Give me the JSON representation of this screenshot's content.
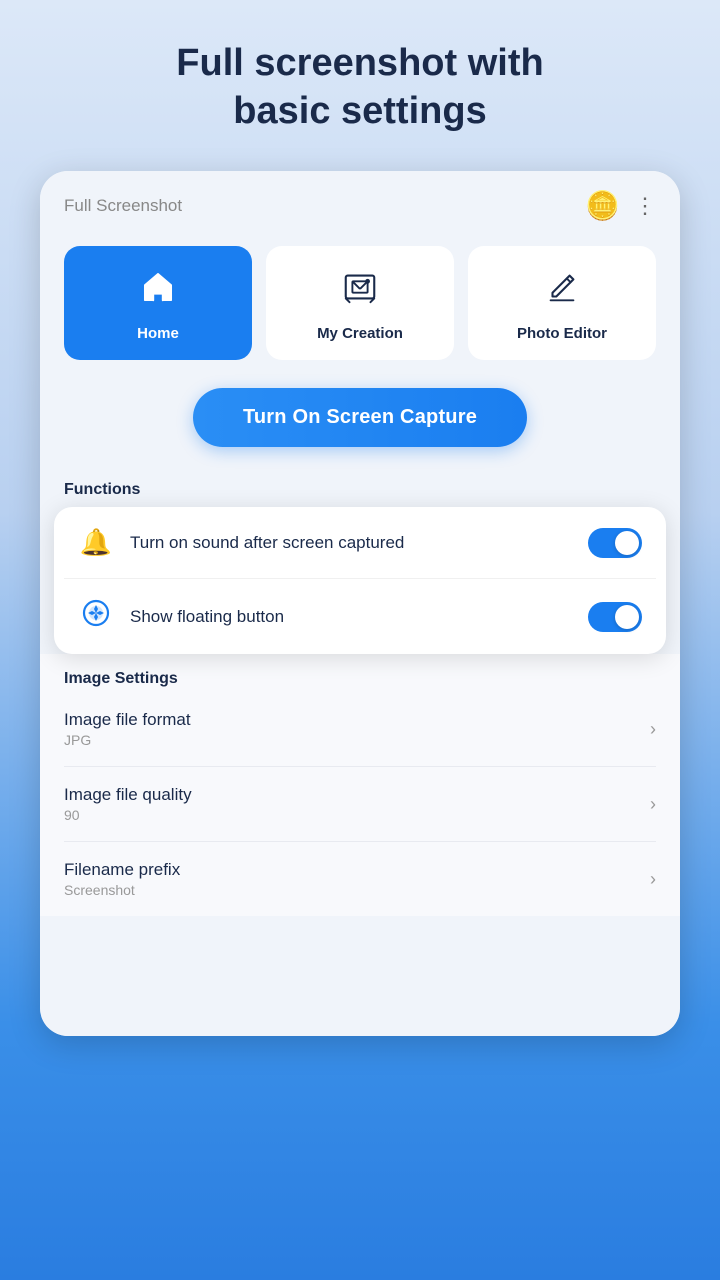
{
  "page": {
    "title_line1": "Full screenshot with",
    "title_line2": "basic settings"
  },
  "app_bar": {
    "title": "Full Screenshot",
    "avatar_emoji": "🪙"
  },
  "nav_tiles": [
    {
      "id": "home",
      "label": "Home",
      "active": true
    },
    {
      "id": "my-creation",
      "label": "My Creation",
      "active": false
    },
    {
      "id": "photo-editor",
      "label": "Photo Editor",
      "active": false
    }
  ],
  "cta_button": {
    "label": "Turn On Screen Capture"
  },
  "functions": {
    "section_label": "Functions",
    "toggles": [
      {
        "id": "sound-toggle",
        "label": "Turn on sound after screen captured",
        "enabled": true,
        "icon": "bell"
      },
      {
        "id": "floating-button-toggle",
        "label": "Show floating button",
        "enabled": true,
        "icon": "shutter"
      }
    ]
  },
  "image_settings": {
    "section_label": "Image Settings",
    "rows": [
      {
        "id": "file-format",
        "title": "Image file format",
        "value": "JPG"
      },
      {
        "id": "file-quality",
        "title": "Image file quality",
        "value": "90"
      },
      {
        "id": "filename-prefix",
        "title": "Filename prefix",
        "value": "Screenshot"
      }
    ]
  }
}
